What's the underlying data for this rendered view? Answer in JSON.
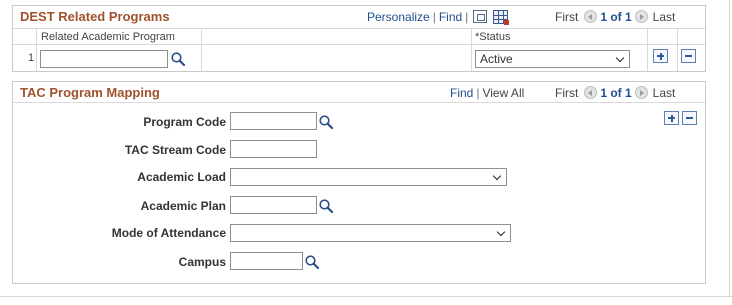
{
  "dest_grid": {
    "title": "DEST Related Programs",
    "nav": {
      "personalize": "Personalize",
      "find": "Find",
      "sep": "|"
    },
    "pager": {
      "first": "First",
      "count": "1 of 1",
      "last": "Last"
    },
    "columns": {
      "related_program": "Related Academic Program",
      "required_mark": "*",
      "status": "Status"
    },
    "rows": [
      {
        "num": "1",
        "related_program_value": "",
        "status_value": "Active"
      }
    ]
  },
  "tac_grid": {
    "title": "TAC Program Mapping",
    "nav": {
      "find": "Find",
      "view_all": "View All",
      "sep": "|"
    },
    "pager": {
      "first": "First",
      "count": "1 of 1",
      "last": "Last"
    },
    "fields": {
      "program_code": {
        "label": "Program Code",
        "value": ""
      },
      "tac_stream_code": {
        "label": "TAC Stream Code",
        "value": ""
      },
      "academic_load": {
        "label": "Academic Load",
        "value": ""
      },
      "academic_plan": {
        "label": "Academic Plan",
        "value": ""
      },
      "mode_of_attendance": {
        "label": "Mode of Attendance",
        "value": ""
      },
      "campus": {
        "label": "Campus",
        "value": ""
      }
    }
  },
  "colors": {
    "title": "#a0522d",
    "link": "#1f4e8c",
    "border": "#c9c9c9"
  },
  "icons": [
    "lookup-icon",
    "zoom-icon",
    "grid-download-icon",
    "previous-icon",
    "next-icon",
    "add-row-icon",
    "delete-row-icon",
    "chevron-down-icon"
  ]
}
